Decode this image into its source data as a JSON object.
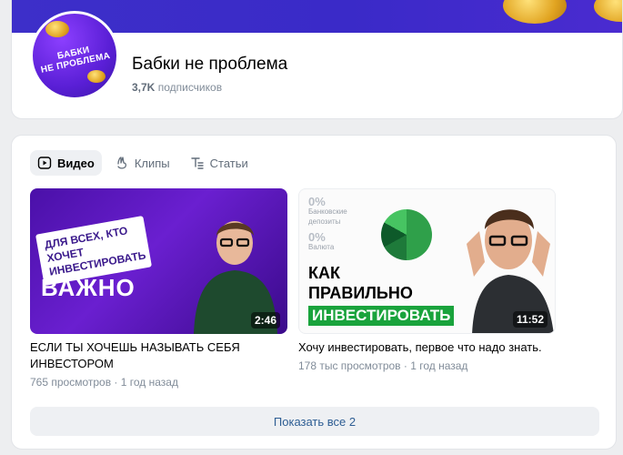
{
  "group": {
    "name": "Бабки не проблема",
    "subscribers_count": "3,7K",
    "subscribers_label": "подписчиков",
    "avatar_text_line1": "БАБКИ",
    "avatar_text_line2": "НЕ ПРОБЛЕМА"
  },
  "tabs": [
    {
      "label": "Видео",
      "icon": "play-icon",
      "active": true
    },
    {
      "label": "Клипы",
      "icon": "clips-icon",
      "active": false
    },
    {
      "label": "Статьи",
      "icon": "articles-icon",
      "active": false
    }
  ],
  "videos": [
    {
      "title": "ЕСЛИ ТЫ ХОЧЕШЬ НАЗЫВАТЬ СЕБЯ ИНВЕСТОРОМ",
      "duration": "2:46",
      "meta": "765 просмотров · 1 год назад",
      "thumb_sticker": "ДЛЯ ВСЕХ, КТО ХОЧЕТ ИНВЕСТИРОВАТЬ",
      "thumb_big": "ВАЖНО"
    },
    {
      "title": "Хочу инвестировать, первое что надо знать.",
      "duration": "11:52",
      "meta": "178 тыс просмотров · 1 год назад",
      "thumb_pct1": "0%",
      "thumb_label1": "Банковские депозиты",
      "thumb_pct2": "0%",
      "thumb_label2": "Валюта",
      "thumb_line1": "КАК",
      "thumb_line2": "ПРАВИЛЬНО",
      "thumb_line3": "ИНВЕСТИРОВАТЬ"
    }
  ],
  "show_all_label": "Показать все 2",
  "colors": {
    "cover": "#3d2fc9",
    "accent_link": "#2d5d93",
    "muted_text": "#818c99",
    "page_bg": "#edeef0"
  }
}
